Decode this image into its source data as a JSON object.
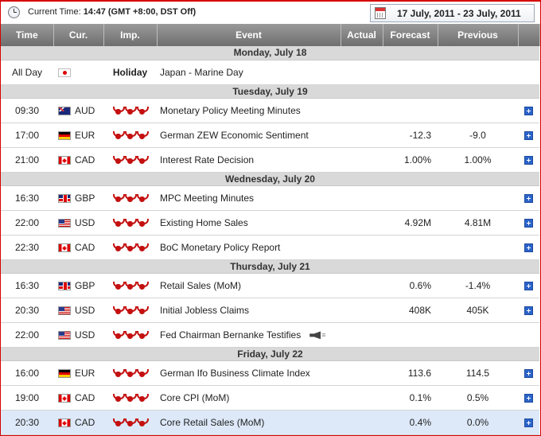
{
  "header": {
    "current_time_label": "Current Time:",
    "current_time_value": "14:47 (GMT +8:00, DST Off)",
    "date_range": "17 July, 2011 - 23 July, 2011"
  },
  "columns": {
    "time": "Time",
    "currency": "Cur.",
    "importance": "Imp.",
    "event": "Event",
    "actual": "Actual",
    "forecast": "Forecast",
    "previous": "Previous"
  },
  "days": [
    {
      "label": "Monday, July 18",
      "events": [
        {
          "time": "All Day",
          "flag": "jp",
          "currency": "",
          "importance": "Holiday",
          "event": "Japan - Marine Day",
          "actual": "",
          "forecast": "",
          "previous": "",
          "expand": false
        }
      ]
    },
    {
      "label": "Tuesday, July 19",
      "events": [
        {
          "time": "09:30",
          "flag": "au",
          "currency": "AUD",
          "importance": 3,
          "event": "Monetary Policy Meeting Minutes",
          "actual": "",
          "forecast": "",
          "previous": "",
          "expand": true
        },
        {
          "time": "17:00",
          "flag": "eu",
          "currency": "EUR",
          "importance": 3,
          "event": "German ZEW Economic Sentiment",
          "actual": "",
          "forecast": "-12.3",
          "previous": "-9.0",
          "expand": true
        },
        {
          "time": "21:00",
          "flag": "ca",
          "currency": "CAD",
          "importance": 3,
          "event": "Interest Rate Decision",
          "actual": "",
          "forecast": "1.00%",
          "previous": "1.00%",
          "expand": true
        }
      ]
    },
    {
      "label": "Wednesday, July 20",
      "events": [
        {
          "time": "16:30",
          "flag": "gb",
          "currency": "GBP",
          "importance": 3,
          "event": "MPC Meeting Minutes",
          "actual": "",
          "forecast": "",
          "previous": "",
          "expand": true
        },
        {
          "time": "22:00",
          "flag": "us",
          "currency": "USD",
          "importance": 3,
          "event": "Existing Home Sales",
          "actual": "",
          "forecast": "4.92M",
          "previous": "4.81M",
          "expand": true
        },
        {
          "time": "22:30",
          "flag": "ca",
          "currency": "CAD",
          "importance": 3,
          "event": "BoC Monetary Policy Report",
          "actual": "",
          "forecast": "",
          "previous": "",
          "expand": true
        }
      ]
    },
    {
      "label": "Thursday, July 21",
      "events": [
        {
          "time": "16:30",
          "flag": "gb",
          "currency": "GBP",
          "importance": 3,
          "event": "Retail Sales (MoM)",
          "actual": "",
          "forecast": "0.6%",
          "previous": "-1.4%",
          "expand": true
        },
        {
          "time": "20:30",
          "flag": "us",
          "currency": "USD",
          "importance": 3,
          "event": "Initial Jobless Claims",
          "actual": "",
          "forecast": "408K",
          "previous": "405K",
          "expand": true
        },
        {
          "time": "22:00",
          "flag": "us",
          "currency": "USD",
          "importance": 3,
          "event": "Fed Chairman Bernanke Testifies",
          "speech": true,
          "actual": "",
          "forecast": "",
          "previous": "",
          "expand": false
        }
      ]
    },
    {
      "label": "Friday, July 22",
      "events": [
        {
          "time": "16:00",
          "flag": "eu",
          "currency": "EUR",
          "importance": 3,
          "event": "German Ifo Business Climate Index",
          "actual": "",
          "forecast": "113.6",
          "previous": "114.5",
          "expand": true
        },
        {
          "time": "19:00",
          "flag": "ca",
          "currency": "CAD",
          "importance": 3,
          "event": "Core CPI (MoM)",
          "actual": "",
          "forecast": "0.1%",
          "previous": "0.5%",
          "expand": true
        },
        {
          "time": "20:30",
          "flag": "ca",
          "currency": "CAD",
          "importance": 3,
          "event": "Core Retail Sales (MoM)",
          "actual": "",
          "forecast": "0.4%",
          "previous": "0.0%",
          "expand": true,
          "highlight": true
        }
      ]
    }
  ],
  "icons": {
    "bull": "bull-icon",
    "plus": "expand-plus-icon",
    "speech": "speech-icon",
    "clock": "clock-icon",
    "calendar": "calendar-icon"
  },
  "colors": {
    "frame": "#d60000",
    "header_bg": "#808080",
    "day_row_bg": "#d9d9d9",
    "bull_red": "#c41010",
    "plus_blue": "#2c64c8",
    "highlight_row": "#dde9f9"
  }
}
